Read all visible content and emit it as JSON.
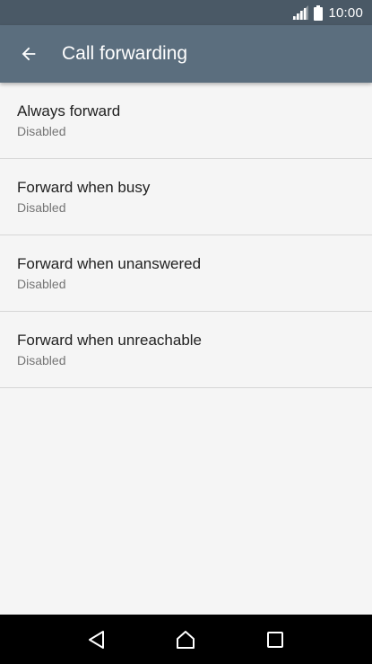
{
  "status_bar": {
    "time": "10:00",
    "icons": [
      "signal-icon",
      "battery-icon"
    ]
  },
  "app_bar": {
    "back_icon": "arrow-back-icon",
    "title": "Call forwarding"
  },
  "list": {
    "items": [
      {
        "title": "Always forward",
        "subtitle": "Disabled"
      },
      {
        "title": "Forward when busy",
        "subtitle": "Disabled"
      },
      {
        "title": "Forward when unanswered",
        "subtitle": "Disabled"
      },
      {
        "title": "Forward when unreachable",
        "subtitle": "Disabled"
      }
    ]
  },
  "nav_bar": {
    "icons": [
      "back-triangle-icon",
      "home-icon",
      "recents-icon"
    ]
  },
  "colors": {
    "status_bar": "#4a5966",
    "app_bar": "#5b6e7e",
    "background": "#f5f5f5",
    "nav_bar": "#000000"
  }
}
